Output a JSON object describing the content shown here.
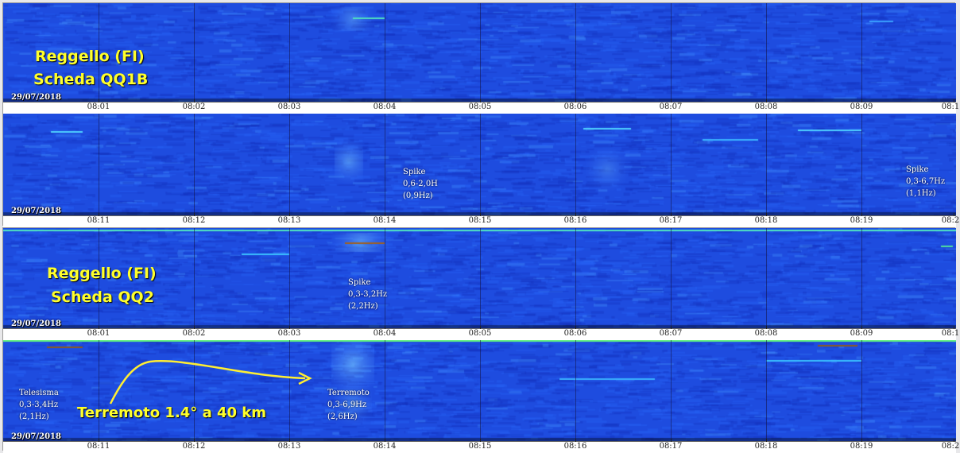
{
  "chart_data": [
    {
      "type": "heatmap",
      "title": "Reggello (FI) Scheda QQ1B",
      "date": "29/07/2018",
      "ticks": [
        "08:01",
        "08:02",
        "08:03",
        "08:04",
        "08:05",
        "08:06",
        "08:07",
        "08:08",
        "08:09",
        "08:1"
      ]
    },
    {
      "type": "heatmap",
      "date": "29/07/2018",
      "ticks": [
        "08:11",
        "08:12",
        "08:13",
        "08:14",
        "08:15",
        "08:16",
        "08:17",
        "08:18",
        "08:19",
        "08:2"
      ],
      "annotations": [
        {
          "lines": [
            "Spike",
            "0,6-2,0H",
            "(0,9Hz)"
          ]
        },
        {
          "lines": [
            "Spike",
            "0,3-6,7Hz",
            "(1,1Hz)"
          ]
        }
      ]
    },
    {
      "type": "heatmap",
      "title": "Reggello (FI) Scheda QQ2",
      "date": "29/07/2018",
      "ticks": [
        "08:01",
        "08:02",
        "08:03",
        "08:04",
        "08:05",
        "08:06",
        "08:07",
        "08:08",
        "08:09",
        "08:1"
      ],
      "annotations": [
        {
          "lines": [
            "Spike",
            "0,3-3,2Hz",
            "(2,2Hz)"
          ]
        }
      ]
    },
    {
      "type": "heatmap",
      "date": "29/07/2018",
      "ticks": [
        "08:11",
        "08:12",
        "08:13",
        "08:14",
        "08:15",
        "08:16",
        "08:17",
        "08:18",
        "08:19",
        "08:2"
      ],
      "annotations": [
        {
          "lines": [
            "Telesisma",
            "0,3-3,4Hz",
            "(2,1Hz)"
          ]
        },
        {
          "lines": [
            "Terremoto",
            "0,3-6,9Hz",
            "(2,6Hz)"
          ]
        },
        {
          "lines": [
            "Terremoto 1.4° a 40 km"
          ]
        }
      ]
    }
  ],
  "titles": {
    "qq1b_line1": "Reggello (FI)",
    "qq1b_line2": "Scheda QQ1B",
    "qq2_line1": "Reggello (FI)",
    "qq2_line2": "Scheda QQ2"
  },
  "colors": {
    "background_blue": "#1f4fe0",
    "label_yellow": "#ffff2a",
    "arrow_yellow": "#ffee33"
  }
}
